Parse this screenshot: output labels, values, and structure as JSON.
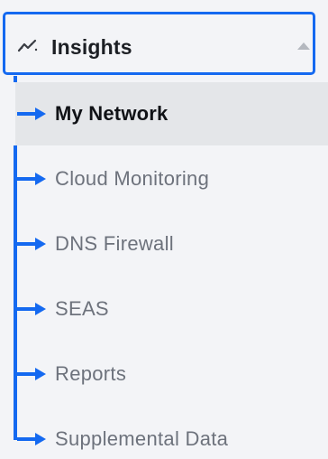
{
  "section": {
    "title": "Insights",
    "icon": "trend-line-icon",
    "expanded": true,
    "caret_icon": "caret-up-icon"
  },
  "nav": {
    "items": [
      {
        "label": "My Network",
        "active": true
      },
      {
        "label": "Cloud Monitoring",
        "active": false
      },
      {
        "label": "DNS Firewall",
        "active": false
      },
      {
        "label": "SEAS",
        "active": false
      },
      {
        "label": "Reports",
        "active": false
      },
      {
        "label": "Supplemental Data",
        "active": false
      }
    ]
  },
  "colors": {
    "highlight": "#1469f0",
    "active_bg": "#e4e6e9",
    "text_muted": "#6d727c",
    "text_active": "#101216",
    "panel_bg": "#f3f4f7"
  }
}
